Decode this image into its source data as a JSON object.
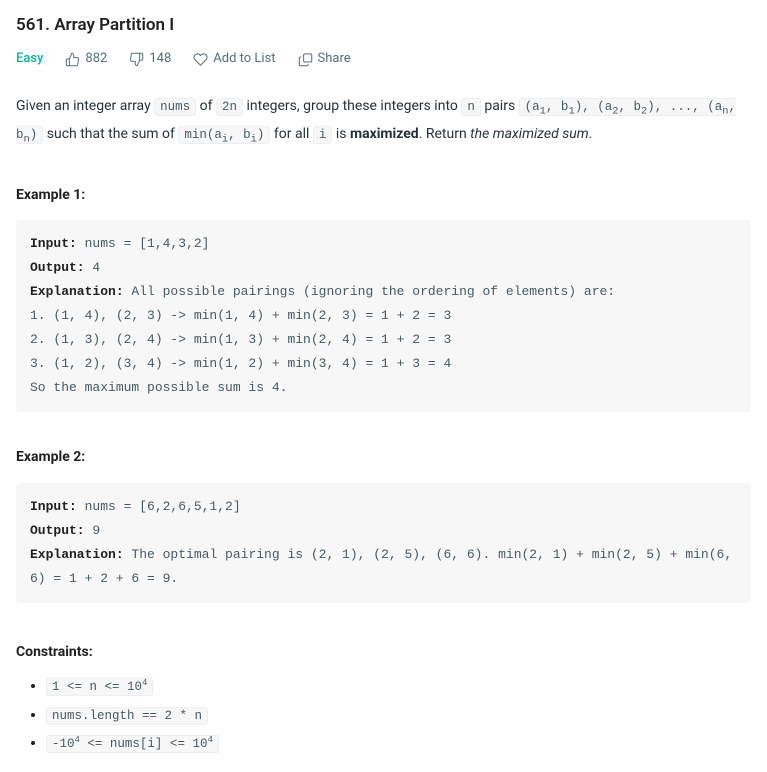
{
  "title": "561. Array Partition I",
  "difficulty": "Easy",
  "likes": "882",
  "dislikes": "148",
  "add_to_list": "Add to List",
  "share": "Share",
  "description_html": "Given an integer array <code>nums</code> of <code>2n</code> integers, group these integers into <code>n</code> pairs <code>(a<sub>1</sub>, b<sub>1</sub>), (a<sub>2</sub>, b<sub>2</sub>), ..., (a<sub>n</sub>, b<sub>n</sub>)</code> such that the sum of <code>min(a<sub>i</sub>, b<sub>i</sub>)</code> for all <code>i</code> is <strong>maximized</strong>. Return <em>the maximized sum</em>.",
  "example1_label": "Example 1:",
  "example1_html": "<strong>Input:</strong> nums = [1,4,3,2]\n<strong>Output:</strong> 4\n<strong>Explanation:</strong> All possible pairings (ignoring the ordering of elements) are:\n1. (1, 4), (2, 3) -> min(1, 4) + min(2, 3) = 1 + 2 = 3\n2. (1, 3), (2, 4) -> min(1, 3) + min(2, 4) = 1 + 2 = 3\n3. (1, 2), (3, 4) -> min(1, 2) + min(3, 4) = 1 + 3 = 4\nSo the maximum possible sum is 4.",
  "example2_label": "Example 2:",
  "example2_html": "<strong>Input:</strong> nums = [6,2,6,5,1,2]\n<strong>Output:</strong> 9\n<strong>Explanation:</strong> The optimal pairing is (2, 1), (2, 5), (6, 6). min(2, 1) + min(2, 5) + min(6, 6) = 1 + 2 + 6 = 9.",
  "constraints_label": "Constraints:",
  "constraints_html": [
    "<code>1 &lt;= n &lt;= 10<sup>4</sup></code>",
    "<code>nums.length == 2 * n</code>",
    "<code>-10<sup>4</sup> &lt;= nums[i] &lt;= 10<sup>4</sup></code>"
  ]
}
